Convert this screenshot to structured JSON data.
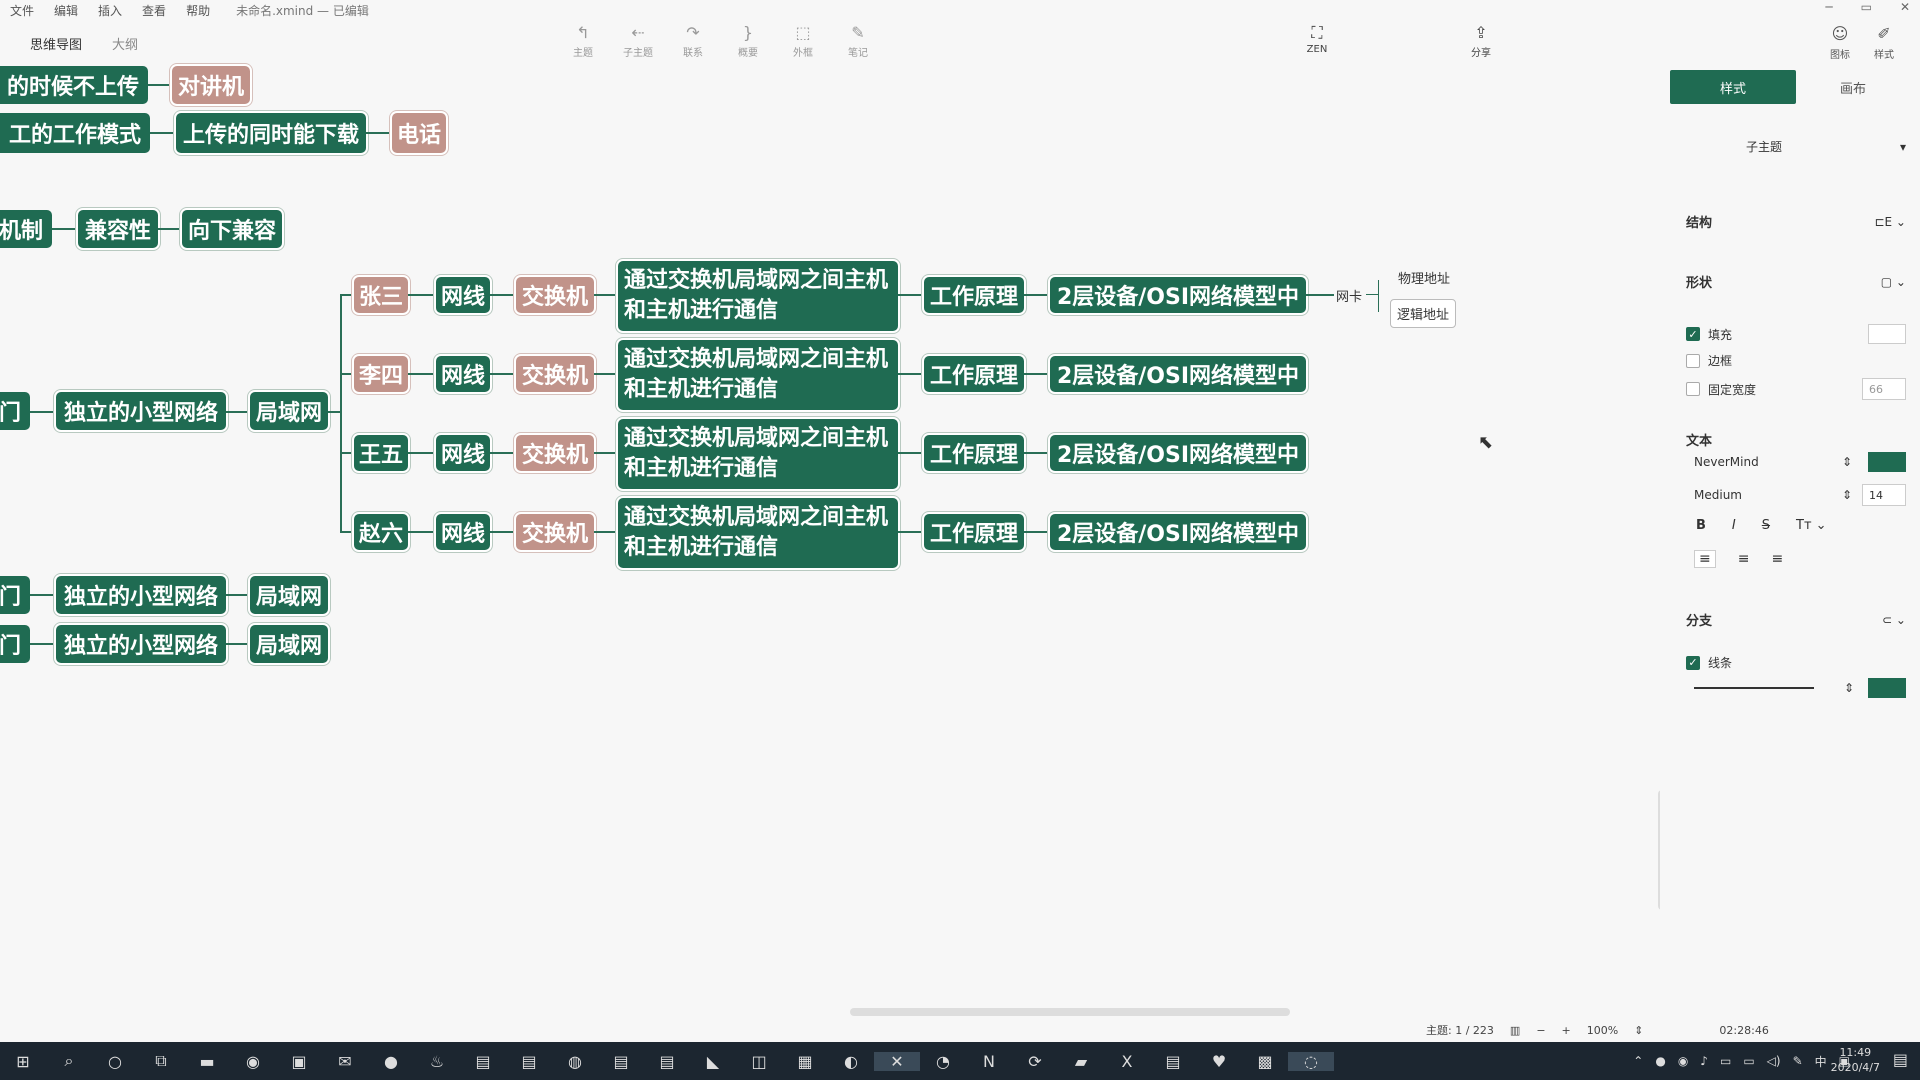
{
  "menu": {
    "items": [
      "文件",
      "编辑",
      "插入",
      "查看",
      "帮助"
    ],
    "doc_title": "未命名.xmind — 已编辑"
  },
  "view_tabs": {
    "mindmap": "思维导图",
    "outline": "大纲"
  },
  "toolbar": {
    "topic": "主题",
    "subtopic": "子主题",
    "relation": "联系",
    "summary": "概要",
    "boundary": "外框",
    "note": "笔记",
    "zen": "ZEN",
    "share": "分享",
    "icon": "图标",
    "style": "样式"
  },
  "nodes": {
    "n1a": "的时候不上传",
    "n1b": "对讲机",
    "n2a": "工的工作模式",
    "n2b": "上传的同时能下载",
    "n2c": "电话",
    "n3a": "机制",
    "n3b": "兼容性",
    "n3c": "向下兼容",
    "dept1": "门",
    "dept2": "门",
    "dept3": "门",
    "small_net": "独立的小型网络",
    "lan": "局域网",
    "persons": [
      "张三",
      "李四",
      "王五",
      "赵六"
    ],
    "cable": "网线",
    "switch": "交换机",
    "comm": "通过交换机局域网之间主机和主机进行通信",
    "principle": "工作原理",
    "layer": "2层设备/OSI网络模型中",
    "nic": "网卡",
    "phys": "物理地址",
    "logic": "逻辑地址"
  },
  "panel": {
    "tab_style": "样式",
    "tab_canvas": "画布",
    "sub_topic": "子主题",
    "structure": "结构",
    "shape": "形状",
    "fill": "填充",
    "border": "边框",
    "fixed_width": "固定宽度",
    "fixed_width_val": "66",
    "text": "文本",
    "font": "NeverMind",
    "weight": "Medium",
    "size": "14",
    "branch": "分支",
    "line": "线条",
    "accent": "#1f6b52"
  },
  "status": {
    "topics": "主题: 1 / 223",
    "zoom": "100%",
    "timer": "02:28:46"
  },
  "taskbar": {
    "ime": "中",
    "time": "11:49",
    "date": "2020/4/7"
  }
}
